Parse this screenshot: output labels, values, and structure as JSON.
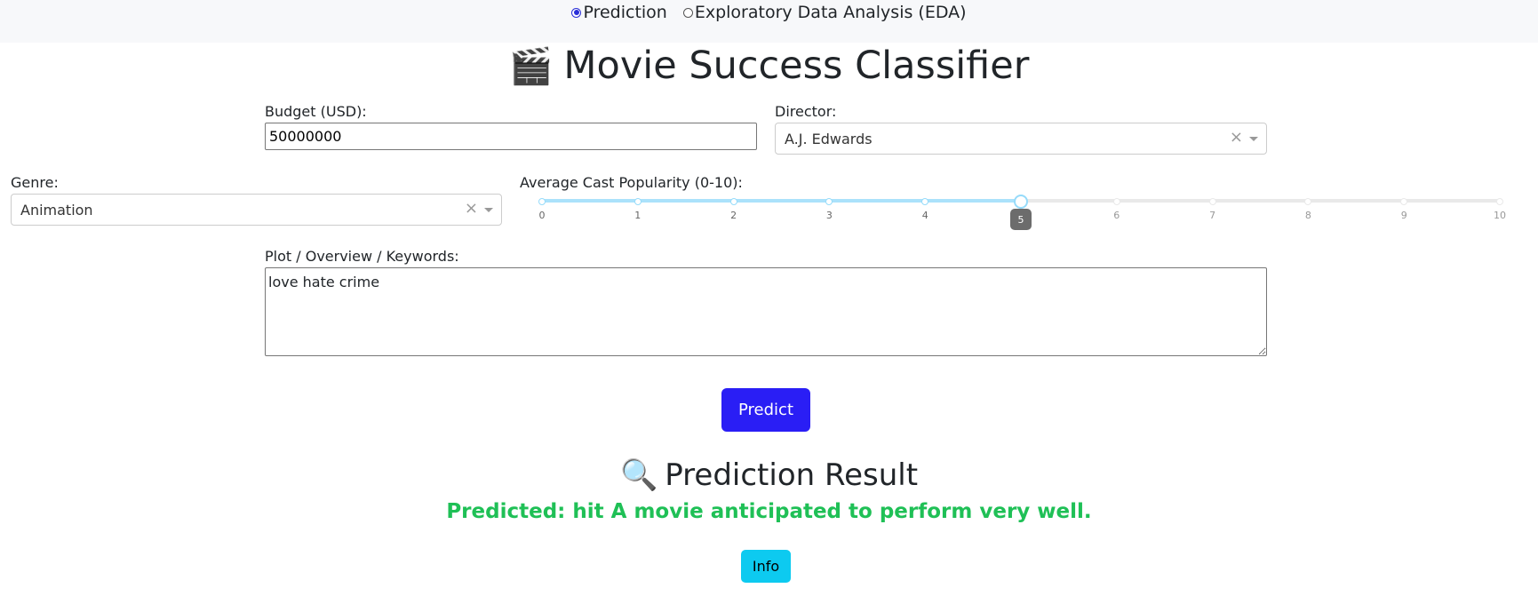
{
  "nav": {
    "options": [
      {
        "label": "Prediction",
        "selected": true
      },
      {
        "label": "Exploratory Data Analysis (EDA)",
        "selected": false
      }
    ]
  },
  "page": {
    "title_icon": "🎬",
    "title": "Movie Success Classifier"
  },
  "form": {
    "budget": {
      "label": "Budget (USD):",
      "value": "50000000"
    },
    "director": {
      "label": "Director:",
      "value": "A.J. Edwards",
      "clear": "×"
    },
    "genre": {
      "label": "Genre:",
      "value": "Animation",
      "clear": "×"
    },
    "cast_popularity": {
      "label": "Average Cast Popularity (0-10):",
      "min": 0,
      "max": 10,
      "value": 5,
      "marks": [
        "0",
        "1",
        "2",
        "3",
        "4",
        "5",
        "6",
        "7",
        "8",
        "9",
        "10"
      ],
      "tooltip": "5"
    },
    "plot": {
      "label": "Plot / Overview / Keywords:",
      "value": "love hate crime"
    }
  },
  "actions": {
    "predict_label": "Predict",
    "info_label": "Info"
  },
  "result": {
    "title_icon": "🔍",
    "title": "Prediction Result",
    "text": "Predicted: hit A movie anticipated to perform very well.",
    "text_color": "#1fc056"
  },
  "colors": {
    "accent": "#2a1ef5",
    "info": "#0dcaf0",
    "slider_track": "#abe2fb"
  }
}
